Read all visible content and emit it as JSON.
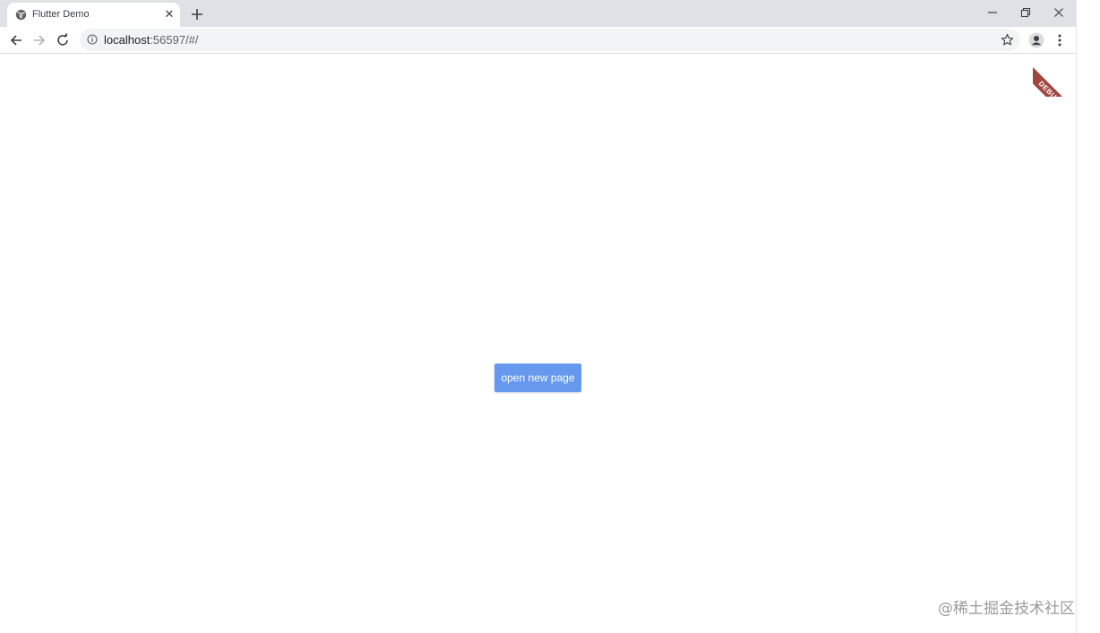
{
  "browser": {
    "tab": {
      "title": "Flutter Demo",
      "close_glyph": "✕",
      "favicon": "globe-icon"
    },
    "new_tab_icon": "plus-icon",
    "window_controls": [
      "minimize-icon",
      "restore-icon",
      "close-icon"
    ],
    "toolbar": {
      "back_icon": "arrow-left-icon",
      "forward_icon": "arrow-right-icon",
      "reload_icon": "reload-icon",
      "url_host": "localhost",
      "url_rest": ":56597/#/",
      "bookmark_icon": "star-icon",
      "profile_icon": "person-icon",
      "menu_icon": "kebab-menu-icon"
    }
  },
  "app": {
    "debug_banner": "DEBUG",
    "button_label": "open new page",
    "button_color": "#6699ee"
  },
  "watermark": "@稀土掘金技术社区"
}
